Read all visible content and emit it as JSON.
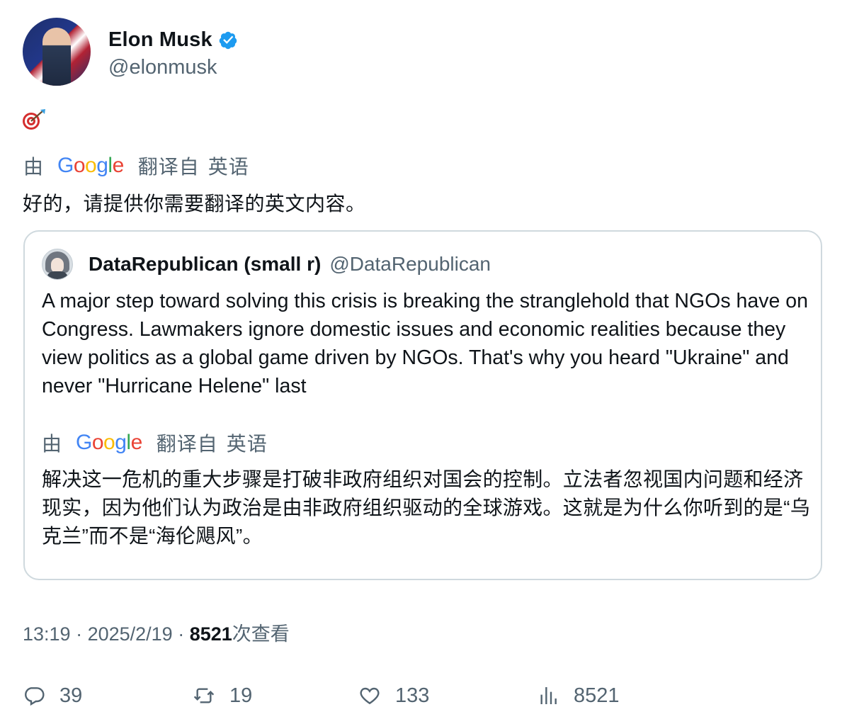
{
  "author": {
    "display_name": "Elon Musk",
    "handle": "@elonmusk",
    "verified_color": "#1d9bf0"
  },
  "tweet": {
    "emoji": "🎯",
    "translate_bar": {
      "by": "由",
      "provider": "Google",
      "from_label": "翻译自",
      "source_lang": "英语"
    },
    "translated_text": "好的，请提供你需要翻译的英文内容。"
  },
  "quote": {
    "display_name": "DataRepublican (small r)",
    "handle": "@DataRepublican",
    "text": "A major step toward solving this crisis is breaking the stranglehold that NGOs have on Congress. Lawmakers ignore domestic issues and economic realities because they view politics as a global game driven by NGOs. That's why you heard \"Ukraine\" and never \"Hurricane Helene\" last",
    "translate_bar": {
      "by": "由",
      "provider": "Google",
      "from_label": "翻译自",
      "source_lang": "英语"
    },
    "translated_text": "解决这一危机的重大步骤是打破非政府组织对国会的控制。立法者忽视国内问题和经济现实，因为他们认为政治是由非政府组织驱动的全球游戏。这就是为什么你听到的是“乌克兰”而不是“海伦飓风”。"
  },
  "meta": {
    "time": "13:19",
    "date": "2025/2/19",
    "separator": " · ",
    "views": "8521",
    "views_label": "次查看"
  },
  "actions": {
    "replies": "39",
    "retweets": "19",
    "likes": "133",
    "views": "8521"
  }
}
